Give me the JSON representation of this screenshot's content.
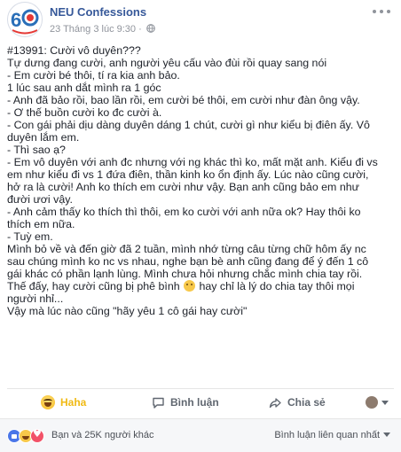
{
  "post": {
    "page_name": "NEU Confessions",
    "timestamp": "23 Tháng 3 lúc 9:30 ·",
    "body_lines": [
      "#13991: Cười vô duyên???",
      "Tự dưng đang cười, anh người yêu cấu vào đùi rồi quay sang nói",
      "- Em cười bé thôi, tí ra kia anh bảo.",
      "1 lúc sau anh dắt mình ra 1 góc",
      "- Anh đã bảo rồi, bao lần rồi, em cười bé thôi, em cười như đàn ông vậy.",
      "- Ơ thế buồn cười ko đc cười à.",
      "- Con gái phải dịu dàng duyên dáng 1 chút, cười gì như kiểu bị điên ấy. Vô",
      "duyên lắm em.",
      "- Thì sao ạ?",
      "- Em vô duyên với anh đc nhưng với ng khác thì ko, mất mặt anh. Kiểu đi vs",
      "em như kiểu đi vs 1 đứa điên, thần kinh ko ổn định ấy. Lúc nào cũng cười,",
      "hở ra là cười! Anh ko thích em cười như vậy. Bạn anh cũng bảo em như",
      "đười ươi vậy.",
      "- Anh cảm thấy ko thích thì thôi, em ko cười với anh nữa ok? Hay thôi ko",
      "thích em nữa.",
      "- Tuỳ em.",
      "Mình bỏ về và đến giờ đã 2 tuần, mình nhớ từng câu từng chữ hôm ấy nc",
      "sau chúng mình ko nc vs nhau, nghe bạn bè anh cũng đang để ý đến 1 cô",
      "gái khác có phần lạnh lùng. Mình chưa hỏi nhưng chắc mình chia tay rồi.",
      "Thế đấy, hay cười cũng bị phê bình",
      "hay chỉ là lý do chia tay thôi mọi",
      "người nhỉ...",
      "Vậy mà lúc nào cũng \"hãy yêu 1 cô gái hay cười\""
    ]
  },
  "actions": {
    "haha_label": "Haha",
    "comment_label": "Bình luận",
    "share_label": "Chia sẻ"
  },
  "footer": {
    "reaction_summary": "Bạn và 25K người khác",
    "sort_label": "Bình luận liên quan nhất"
  },
  "icons": {
    "avatar": "neu-60-logo",
    "more": "more-dots-icon",
    "privacy": "globe-icon",
    "haha": "haha-emoji-icon",
    "comment": "comment-icon",
    "share": "share-icon",
    "inline_emoji": "grin-emoji-icon",
    "reactions": [
      "like-icon",
      "haha-icon",
      "love-icon"
    ]
  },
  "colors": {
    "link_blue": "#365899",
    "meta_gray": "#90949c",
    "haha_yellow": "#f0ba15",
    "footer_bg": "#f6f7f9"
  }
}
